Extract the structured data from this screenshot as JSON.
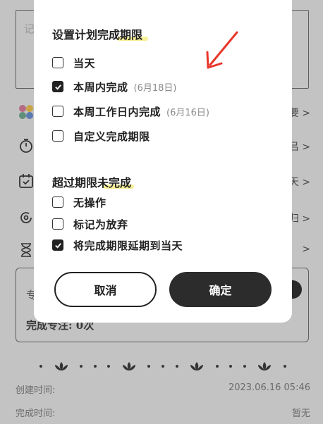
{
  "background": {
    "input_hint": "记",
    "rows": [
      {
        "right_text": "要 >"
      },
      {
        "right_text": "吕 >"
      },
      {
        "right_text": "天 >"
      },
      {
        "right_text": "归 >"
      },
      {
        "right_text": ">"
      }
    ],
    "focus_label": "专",
    "complete_focus": "完成专注: 0次",
    "created_label": "创建时间:",
    "created_value": "2023.06.16 05:46",
    "completed_label": "完成时间:",
    "completed_value": "暂无"
  },
  "dialog": {
    "title": "设置计划完成期限",
    "deadline_options": [
      {
        "label": "当天",
        "hint": "",
        "checked": false
      },
      {
        "label": "本周内完成",
        "hint": "(6月18日)",
        "checked": true
      },
      {
        "label": "本周工作日内完成",
        "hint": "(6月16日)",
        "checked": false
      },
      {
        "label": "自定义完成期限",
        "hint": "",
        "checked": false
      }
    ],
    "overdue_title": "超过期限未完成",
    "overdue_options": [
      {
        "label": "无操作",
        "checked": false
      },
      {
        "label": "标记为放弃",
        "checked": false
      },
      {
        "label": "将完成期限延期到当天",
        "checked": true
      }
    ],
    "cancel_label": "取消",
    "confirm_label": "确定"
  },
  "colors": {
    "accent": "#2c2c2c",
    "highlight": "#f5e96a",
    "annotation_arrow": "#e8362a"
  }
}
